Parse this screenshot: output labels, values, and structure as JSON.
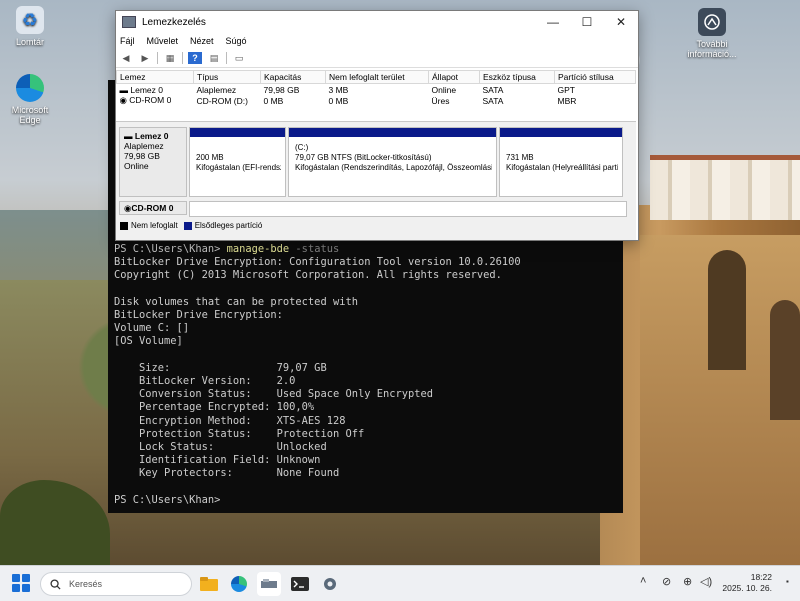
{
  "desktop": {
    "icons": [
      {
        "label": "Lomtár"
      },
      {
        "label": "Microsoft Edge"
      },
      {
        "label": "További információ..."
      }
    ]
  },
  "disk_window": {
    "title": "Lemezkezelés",
    "menu": [
      "Fájl",
      "Művelet",
      "Nézet",
      "Súgó"
    ],
    "columns": [
      "Lemez",
      "Típus",
      "Kapacitás",
      "Nem lefoglalt terület",
      "Állapot",
      "Eszköz típusa",
      "Partíció stílusa"
    ],
    "rows": [
      [
        "Lemez 0",
        "Alaplemez",
        "79,98 GB",
        "3 MB",
        "Online",
        "SATA",
        "GPT"
      ],
      [
        "CD-ROM 0",
        "CD-ROM (D:)",
        "0 MB",
        "0 MB",
        "Üres",
        "SATA",
        "MBR"
      ]
    ],
    "disk0": {
      "name": "Lemez 0",
      "type": "Alaplemez",
      "size": "79,98 GB",
      "status": "Online"
    },
    "partitions": [
      {
        "title": "",
        "line1": "200 MB",
        "line2": "Kifogástalan (EFI-rendszerpartíció)"
      },
      {
        "title": "(C:)",
        "line1": "79,07 GB NTFS (BitLocker-titkosítású)",
        "line2": "Kifogástalan (Rendszerindítás, Lapozófájl, Összeomlási"
      },
      {
        "title": "",
        "line1": "731 MB",
        "line2": "Kifogástalan (Helyreállítási partíció)"
      }
    ],
    "cdrom_label": "CD-ROM 0",
    "legend": {
      "unallocated": "Nem lefoglalt",
      "primary": "Elsődleges partíció"
    },
    "colors": {
      "partition_bar": "#0a1a8a",
      "unallocated": "#000000"
    }
  },
  "terminal": {
    "prompt": "PS C:\\Users\\Khan> ",
    "command": "manage-bde",
    "command_arg": " -status",
    "output": "BitLocker Drive Encryption: Configuration Tool version 10.0.26100\nCopyright (C) 2013 Microsoft Corporation. All rights reserved.\n\nDisk volumes that can be protected with\nBitLocker Drive Encryption:\nVolume C: []\n[OS Volume]\n\n    Size:                 79,07 GB\n    BitLocker Version:    2.0\n    Conversion Status:    Used Space Only Encrypted\n    Percentage Encrypted: 100,0%\n    Encryption Method:    XTS-AES 128\n    Protection Status:    Protection Off\n    Lock Status:          Unlocked\n    Identification Field: Unknown\n    Key Protectors:       None Found\n",
    "final_prompt": "PS C:\\Users\\Khan>"
  },
  "taskbar": {
    "search_placeholder": "Keresés",
    "time": "18:22",
    "date": "2025. 10. 26.",
    "pinned": [
      "file-explorer-icon",
      "edge-icon",
      "disk-management-icon",
      "terminal-icon",
      "settings-icon"
    ]
  }
}
